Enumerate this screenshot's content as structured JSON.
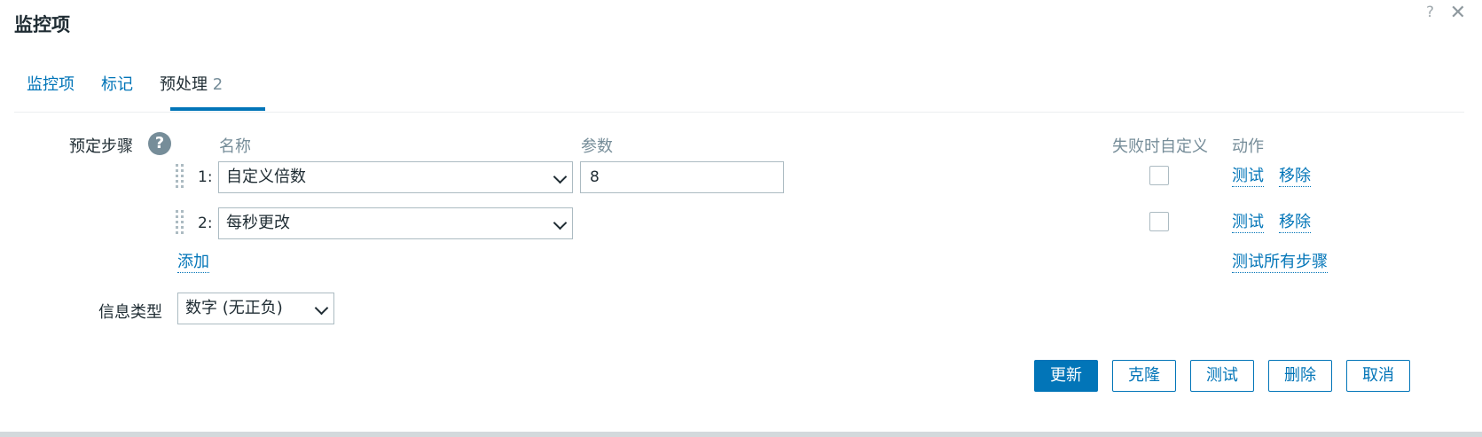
{
  "dialog": {
    "title": "监控项",
    "help_glyph": "?",
    "close_glyph": "✕"
  },
  "tabs": [
    {
      "label": "监控项"
    },
    {
      "label": "标记"
    },
    {
      "label": "预处理",
      "count": "2",
      "active": true
    }
  ],
  "preprocessing": {
    "label": "预定步骤",
    "help_glyph": "?",
    "columns": {
      "name": "名称",
      "params": "参数",
      "custom_on_fail": "失败时自定义",
      "actions": "动作"
    },
    "steps": [
      {
        "num": "1:",
        "name": "自定义倍数",
        "param": "8",
        "custom_on_fail": false,
        "test": "测试",
        "remove": "移除"
      },
      {
        "num": "2:",
        "name": "每秒更改",
        "custom_on_fail": false,
        "test": "测试",
        "remove": "移除"
      }
    ],
    "add_label": "添加",
    "test_all_label": "测试所有步骤"
  },
  "info_type": {
    "label": "信息类型",
    "value": "数字 (无正负)"
  },
  "buttons": {
    "update": "更新",
    "clone": "克隆",
    "test": "测试",
    "delete": "删除",
    "cancel": "取消"
  },
  "colors": {
    "accent": "#0275b8",
    "text": "#1f2c33",
    "muted": "#768d99",
    "border": "#acbbc2"
  }
}
